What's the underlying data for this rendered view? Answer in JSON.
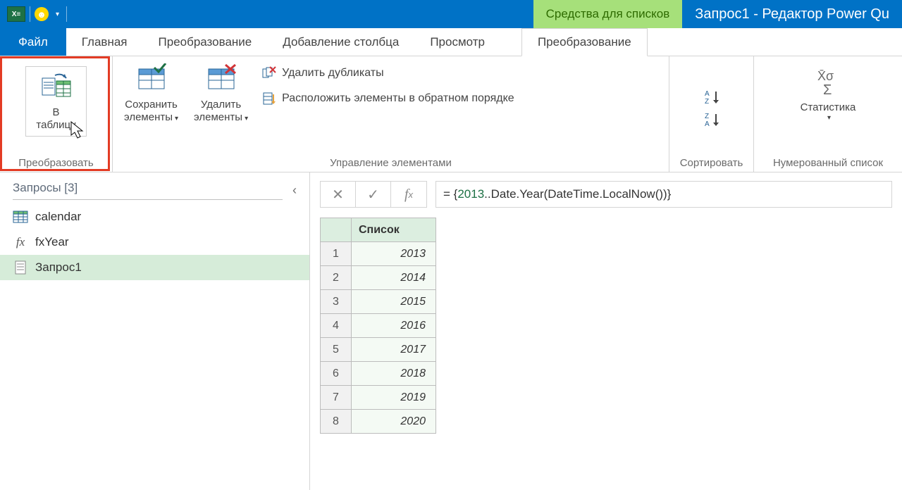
{
  "titlebar": {
    "context_tab_title": "Средства для списков",
    "window_title": "Запрос1 - Редактор Power Qu"
  },
  "tabs": {
    "file": "Файл",
    "home": "Главная",
    "transform": "Преобразование",
    "addcol": "Добавление столбца",
    "view": "Просмотр",
    "context_transform": "Преобразование"
  },
  "ribbon": {
    "convert": {
      "to_table_l1": "В",
      "to_table_l2": "таблицу",
      "group_label": "Преобразовать"
    },
    "manage_elements": {
      "keep_l1": "Сохранить",
      "keep_l2": "элементы",
      "remove_l1": "Удалить",
      "remove_l2": "элементы",
      "remove_dup": "Удалить дубликаты",
      "reverse": "Расположить элементы в обратном порядке",
      "group_label": "Управление элементами"
    },
    "sort": {
      "group_label": "Сортировать"
    },
    "numeric": {
      "stats": "Статистика",
      "group_label": "Нумерованный список"
    }
  },
  "queries": {
    "header": "Запросы [3]",
    "items": [
      {
        "name": "calendar"
      },
      {
        "name": "fxYear"
      },
      {
        "name": "Запрос1"
      }
    ]
  },
  "formula": {
    "prefix": "= {",
    "num": "2013",
    "rest": "..Date.Year(DateTime.LocalNow())}"
  },
  "list": {
    "header": "Список",
    "rows": [
      {
        "n": "1",
        "v": "2013"
      },
      {
        "n": "2",
        "v": "2014"
      },
      {
        "n": "3",
        "v": "2015"
      },
      {
        "n": "4",
        "v": "2016"
      },
      {
        "n": "5",
        "v": "2017"
      },
      {
        "n": "6",
        "v": "2018"
      },
      {
        "n": "7",
        "v": "2019"
      },
      {
        "n": "8",
        "v": "2020"
      }
    ]
  }
}
